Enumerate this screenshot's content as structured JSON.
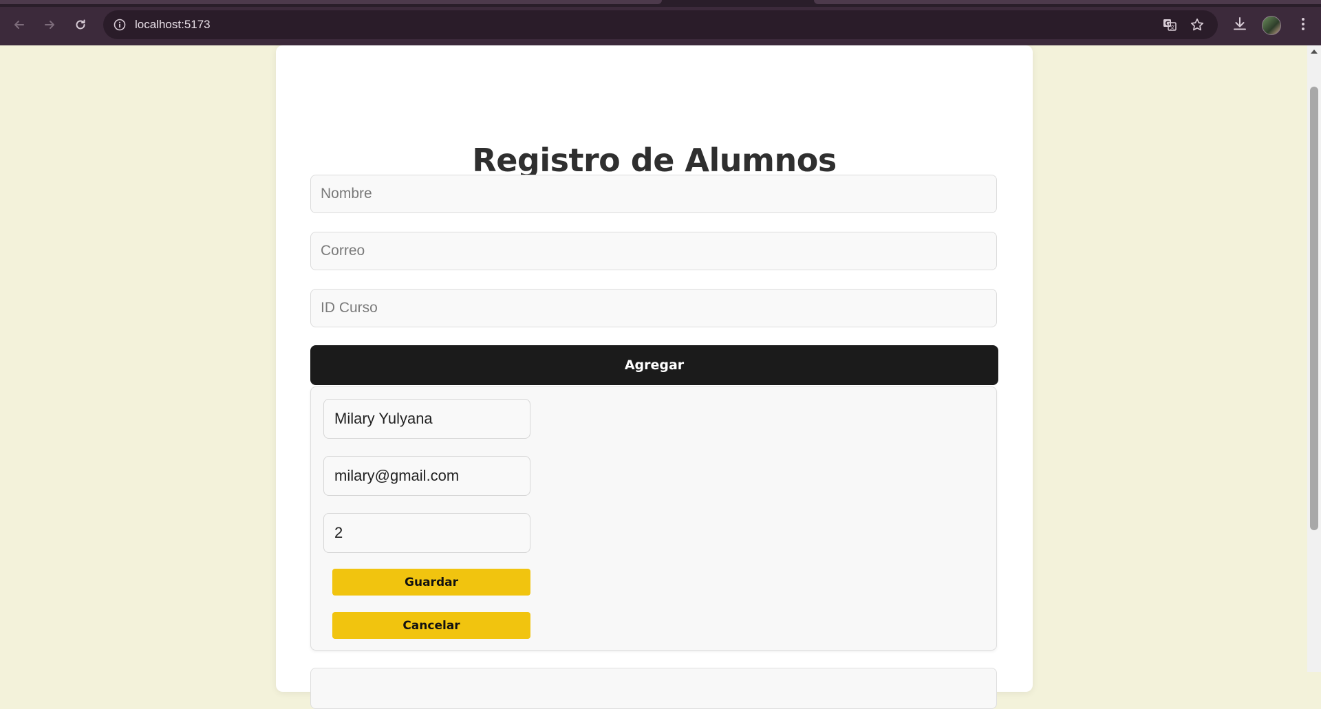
{
  "browser": {
    "url": "localhost:5173",
    "icons": {
      "back": "arrow-left-icon",
      "forward": "arrow-right-icon",
      "reload": "reload-icon",
      "site_info": "info-icon",
      "translate": "translate-icon",
      "bookmark": "star-icon",
      "download": "download-icon",
      "profile": "avatar",
      "menu": "more-vertical-icon"
    },
    "colors": {
      "toolbar": "#3c2a3b",
      "omnibox": "#2a1c29"
    }
  },
  "page": {
    "title": "Registro de Alumnos",
    "form": {
      "nombre_placeholder": "Nombre",
      "correo_placeholder": "Correo",
      "curso_placeholder": "ID Curso",
      "add_label": "Agregar"
    },
    "edit_item": {
      "nombre_value": "Milary Yulyana",
      "correo_value": "milary@gmail.com",
      "curso_value": "2",
      "save_label": "Guardar",
      "cancel_label": "Cancelar"
    },
    "colors": {
      "background": "#f3f2da",
      "add_button": "#1b1b1b",
      "accent_buttons": "#f1c40f"
    }
  }
}
